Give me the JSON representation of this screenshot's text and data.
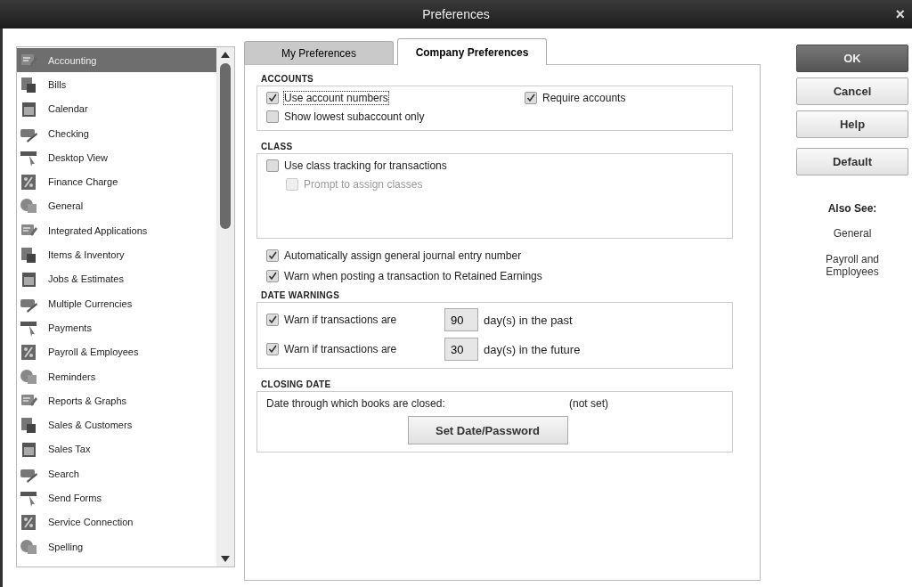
{
  "window": {
    "title": "Preferences",
    "close": "×"
  },
  "sidebar": {
    "items": [
      {
        "label": "Accounting",
        "selected": true
      },
      {
        "label": "Bills",
        "selected": false
      },
      {
        "label": "Calendar",
        "selected": false
      },
      {
        "label": "Checking",
        "selected": false
      },
      {
        "label": "Desktop View",
        "selected": false
      },
      {
        "label": "Finance Charge",
        "selected": false
      },
      {
        "label": "General",
        "selected": false
      },
      {
        "label": "Integrated Applications",
        "selected": false
      },
      {
        "label": "Items & Inventory",
        "selected": false
      },
      {
        "label": "Jobs & Estimates",
        "selected": false
      },
      {
        "label": "Multiple Currencies",
        "selected": false
      },
      {
        "label": "Payments",
        "selected": false
      },
      {
        "label": "Payroll & Employees",
        "selected": false
      },
      {
        "label": "Reminders",
        "selected": false
      },
      {
        "label": "Reports & Graphs",
        "selected": false
      },
      {
        "label": "Sales & Customers",
        "selected": false
      },
      {
        "label": "Sales Tax",
        "selected": false
      },
      {
        "label": "Search",
        "selected": false
      },
      {
        "label": "Send Forms",
        "selected": false
      },
      {
        "label": "Service Connection",
        "selected": false
      },
      {
        "label": "Spelling",
        "selected": false
      }
    ]
  },
  "tabs": [
    {
      "label": "My Preferences",
      "selected": false
    },
    {
      "label": "Company Preferences",
      "selected": true
    }
  ],
  "panel": {
    "blocks": [
      {
        "kind": "group",
        "title": "ACCOUNTS",
        "rows": [
          {
            "kind": "pair",
            "items": [
              {
                "label": "Use account numbers",
                "checked": true,
                "disabled": false,
                "focused": true
              },
              {
                "label": "Require accounts",
                "checked": true,
                "disabled": false,
                "focused": false
              }
            ]
          },
          {
            "kind": "checkbox",
            "label": "Show lowest subaccount only",
            "checked": false,
            "disabled": false,
            "indented": false
          }
        ]
      },
      {
        "kind": "group",
        "title": "CLASS",
        "tall": true,
        "rows": [
          {
            "kind": "checkbox",
            "label": "Use class tracking for transactions",
            "checked": false,
            "disabled": false,
            "indented": false
          },
          {
            "kind": "checkbox",
            "label": "Prompt to assign classes",
            "checked": false,
            "disabled": true,
            "indented": true
          }
        ]
      },
      {
        "kind": "checkbox",
        "label": "Automatically assign general journal entry number",
        "checked": true,
        "disabled": false,
        "indented": false
      },
      {
        "kind": "checkbox",
        "label": "Warn when posting a transaction to Retained Earnings",
        "checked": true,
        "disabled": false,
        "indented": false
      },
      {
        "kind": "group",
        "title": "DATE WARNINGS",
        "rows": [
          {
            "kind": "days",
            "label": "Warn if transactions are",
            "checked": true,
            "value": "90",
            "suffix": "day(s) in the past"
          },
          {
            "kind": "days",
            "label": "Warn if transactions are",
            "checked": true,
            "value": "30",
            "suffix": "day(s) in the future"
          }
        ]
      },
      {
        "kind": "group",
        "title": "CLOSING DATE",
        "rows": [
          {
            "kind": "info",
            "label": "Date through which books are closed:",
            "value": "(not set)"
          },
          {
            "kind": "button",
            "label": "Set Date/Password"
          }
        ]
      }
    ]
  },
  "buttons": [
    {
      "label": "OK",
      "primary": true
    },
    {
      "label": "Cancel",
      "primary": false
    },
    {
      "label": "Help",
      "primary": false
    },
    {
      "label": "Default",
      "primary": false
    }
  ],
  "also_see": {
    "title": "Also See:",
    "links": [
      "General",
      "Payroll and Employees"
    ]
  }
}
